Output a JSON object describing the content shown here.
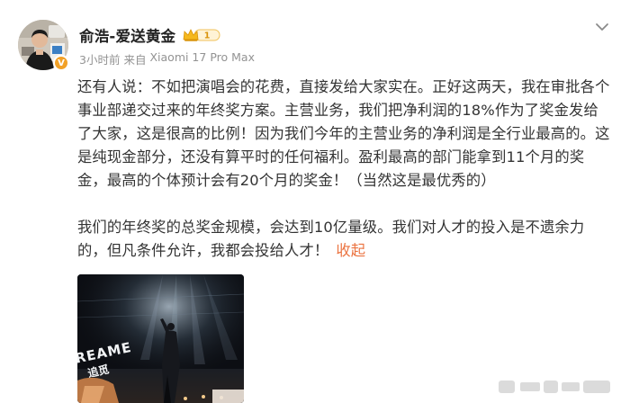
{
  "post": {
    "author": {
      "name": "俞浩-爱送黄金",
      "level": "1"
    },
    "meta": {
      "time": "3小时前",
      "source_prefix": "来自",
      "device": "Xiaomi 17 Pro Max"
    },
    "paragraphs": [
      "还有人说：不如把演唱会的花费，直接发给大家实在。正好这两天，我在审批各个事业部递交过来的年终奖方案。主营业务，我们把净利润的18%作为了奖金发给了大家，这是很高的比例！因为我们今年的主营业务的净利润是全行业最高的。这是纯现金部分，还没有算平时的任何福利。盈利最高的部门能拿到11个月的奖金，最高的个体预计会有20个月的奖金！（当然这是最优秀的）",
      "我们的年终奖的总奖金规模，会达到10亿量级。我们对人才的投入是不遗余力的，但凡条件允许，我都会投给人才！"
    ],
    "collapse_label": "收起",
    "media": {
      "stage_text_en": "REAME",
      "stage_text_cn": "追觅"
    }
  },
  "icons": {
    "verified": "verified-v-icon",
    "crown": "vip-crown-icon",
    "chevron": "chevron-down-icon"
  },
  "colors": {
    "link": "#eb7340",
    "verified": "#f2a127",
    "text": "#333333",
    "meta": "#939393"
  }
}
